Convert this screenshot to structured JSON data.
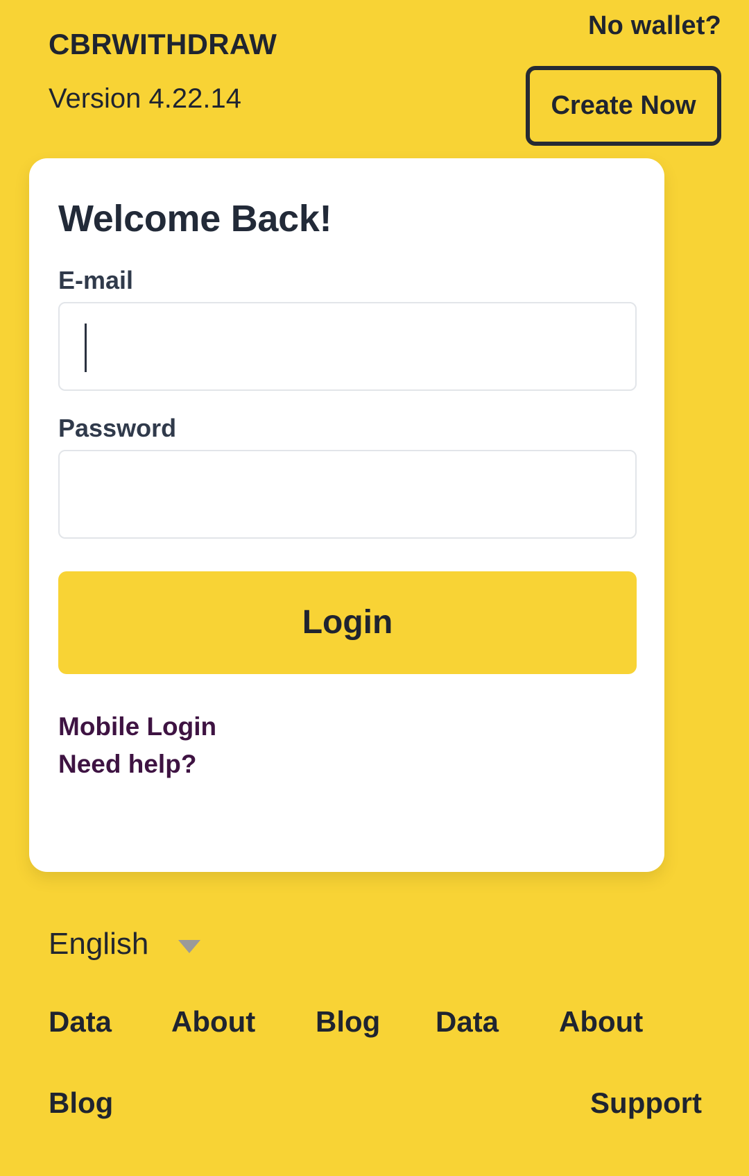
{
  "header": {
    "app_title": "CBRWITHDRAW",
    "version": "Version 4.22.14",
    "no_wallet_label": "No wallet?",
    "create_now_label": "Create Now"
  },
  "card": {
    "heading": "Welcome Back!",
    "email": {
      "label": "E-mail",
      "value": "",
      "placeholder": ""
    },
    "password": {
      "label": "Password",
      "value": "",
      "placeholder": ""
    },
    "login_label": "Login",
    "mobile_login_label": "Mobile Login",
    "need_help_label": "Need help?"
  },
  "language": {
    "value": "English",
    "chevron_icon": "chevron-down-icon"
  },
  "footer": {
    "links_row": [
      "Data",
      "About",
      "Blog",
      "Data",
      "About"
    ],
    "bottom_left": "Blog",
    "bottom_right": "Support"
  },
  "colors": {
    "background_yellow": "#F8D335",
    "text_dark": "#1F2430",
    "link_purple": "#3E1342",
    "card_white": "#FFFFFF",
    "input_border": "#E2E5E9",
    "chevron_gray": "#9A9A9A"
  }
}
